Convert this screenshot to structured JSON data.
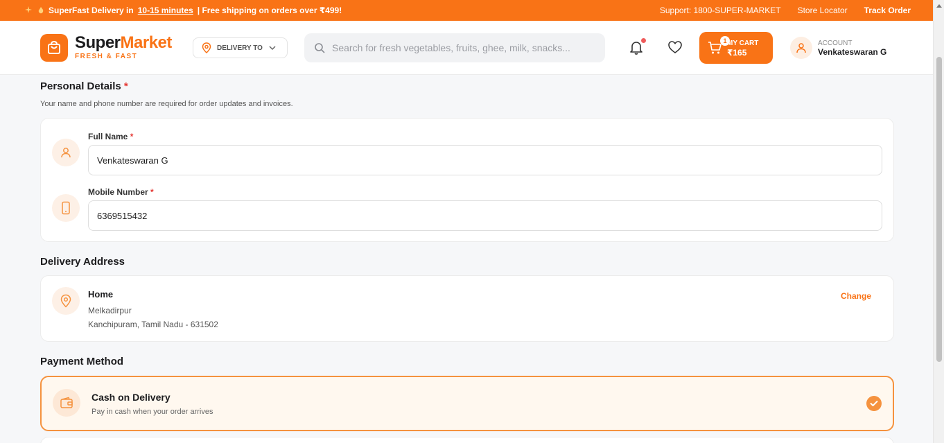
{
  "promo": {
    "text_pre": "SuperFast Delivery in",
    "text_highlight": "10-15 minutes",
    "text_post": "| Free shipping on orders over ₹499!",
    "support": "Support: 1800-SUPER-MARKET",
    "store_locator": "Store Locator",
    "track_order": "Track Order"
  },
  "header": {
    "logo_part1": "Super",
    "logo_part2": "Market",
    "tagline": "FRESH & FAST",
    "delivery_label": "DELIVERY TO",
    "search_placeholder": "Search for fresh vegetables, fruits, ghee, milk, snacks...",
    "cart_count": "1",
    "cart_label": "MY CART",
    "cart_amount": "₹165",
    "account_label": "ACCOUNT",
    "account_name": "Venkateswaran G"
  },
  "personal": {
    "title": "Personal Details",
    "required_mark": "*",
    "subtitle": "Your name and phone number are required for order updates and invoices.",
    "fullname_label": "Full Name",
    "fullname_value": "Venkateswaran G",
    "mobile_label": "Mobile Number",
    "mobile_value": "6369515432"
  },
  "address": {
    "title": "Delivery Address",
    "type": "Home",
    "line1": "Melkadirpur",
    "line2": "Kanchipuram, Tamil Nadu - 631502",
    "change_label": "Change"
  },
  "payment": {
    "title": "Payment Method",
    "option_title": "Cash on Delivery",
    "option_sub": "Pay in cash when your order arrives"
  },
  "colors": {
    "accent": "#f97316",
    "accent_soft": "#fdf0e6",
    "selected_border": "#f5923e"
  }
}
